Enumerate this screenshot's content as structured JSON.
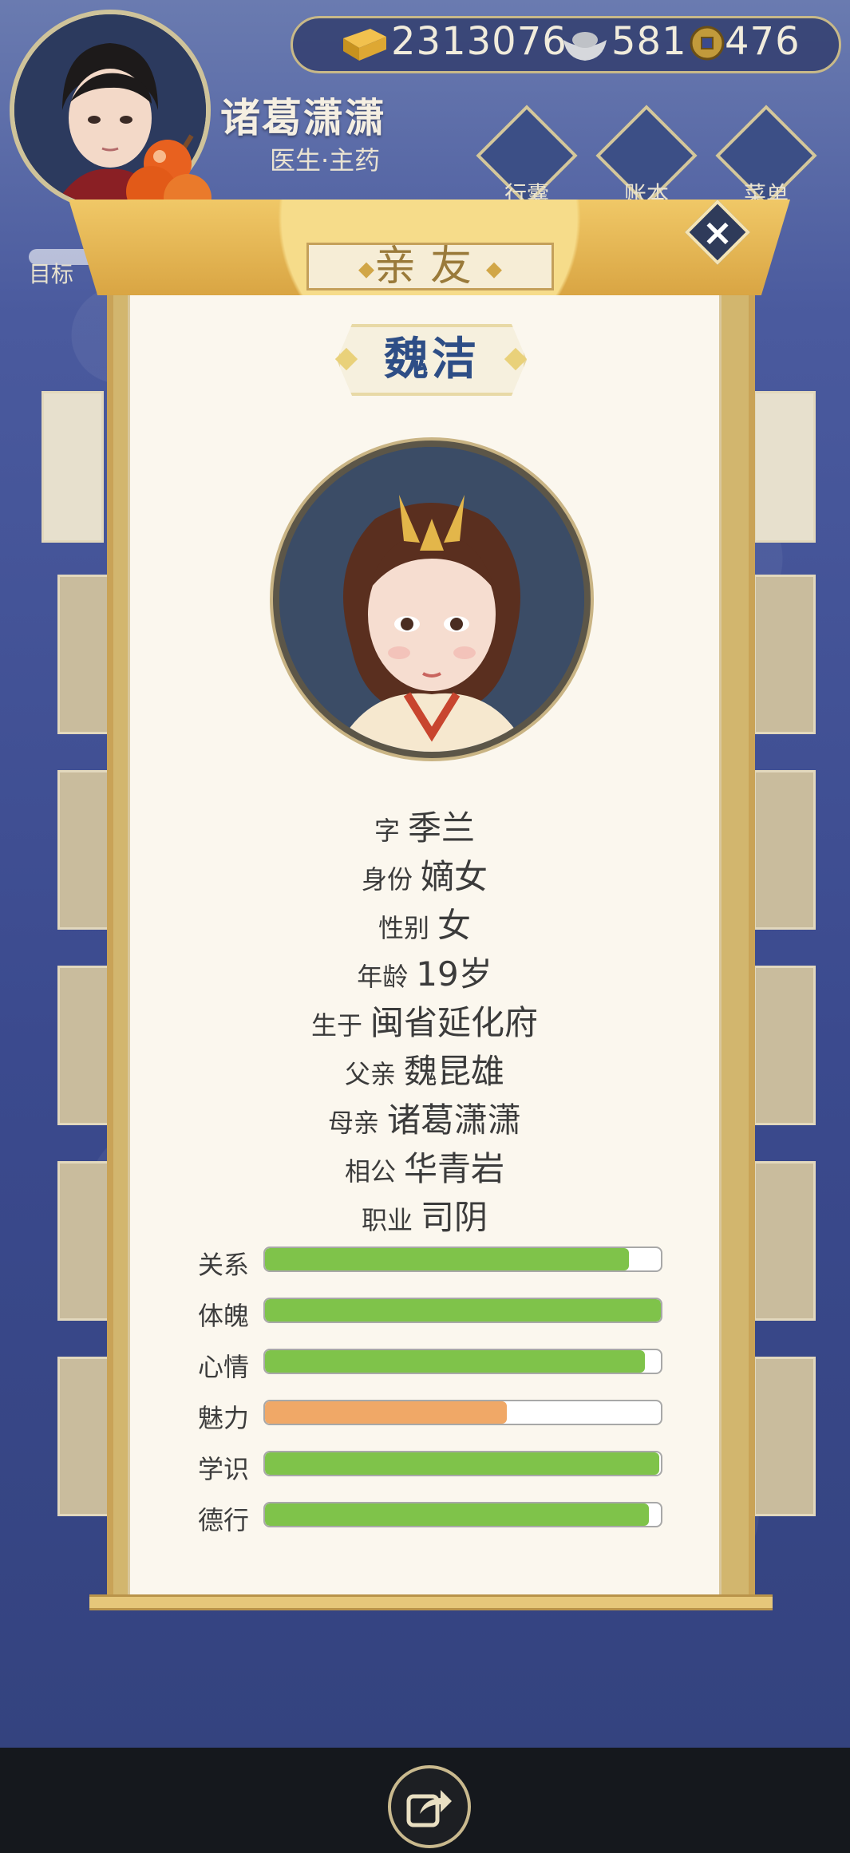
{
  "hud": {
    "player_name": "诸葛潇潇",
    "player_role": "医生·主药",
    "currency": {
      "gold": "2313076",
      "silver": "581",
      "coin": "476"
    },
    "menu": [
      {
        "label": "行囊",
        "icon": "bag-icon"
      },
      {
        "label": "账本",
        "icon": "ledger-icon"
      },
      {
        "label": "菜单",
        "icon": "menu-dots-icon"
      }
    ],
    "goal_label": "目标"
  },
  "panel": {
    "title": "亲友",
    "character_name": "魏洁",
    "info": [
      {
        "key": "字",
        "value": "季兰"
      },
      {
        "key": "身份",
        "value": "嫡女"
      },
      {
        "key": "性别",
        "value": "女"
      },
      {
        "key": "年龄",
        "value": "19岁"
      },
      {
        "key": "生于",
        "value": "闽省延化府"
      },
      {
        "key": "父亲",
        "value": "魏昆雄"
      },
      {
        "key": "母亲",
        "value": "诸葛潇潇"
      },
      {
        "key": "相公",
        "value": "华青岩"
      },
      {
        "key": "职业",
        "value": "司阴"
      }
    ],
    "stats": [
      {
        "label": "关系",
        "value": 0.92,
        "color": "#7fc34a"
      },
      {
        "label": "体魄",
        "value": 1.0,
        "color": "#7fc34a"
      },
      {
        "label": "心情",
        "value": 0.96,
        "color": "#7fc34a"
      },
      {
        "label": "魅力",
        "value": 0.61,
        "color": "#f0a867"
      },
      {
        "label": "学识",
        "value": 0.995,
        "color": "#7fc34a"
      },
      {
        "label": "德行",
        "value": 0.97,
        "color": "#7fc34a"
      }
    ]
  },
  "colors": {
    "bar_green": "#7fc34a",
    "bar_orange": "#f0a867",
    "name_blue": "#2e4e86",
    "frame_gold": "#d2b66e"
  }
}
